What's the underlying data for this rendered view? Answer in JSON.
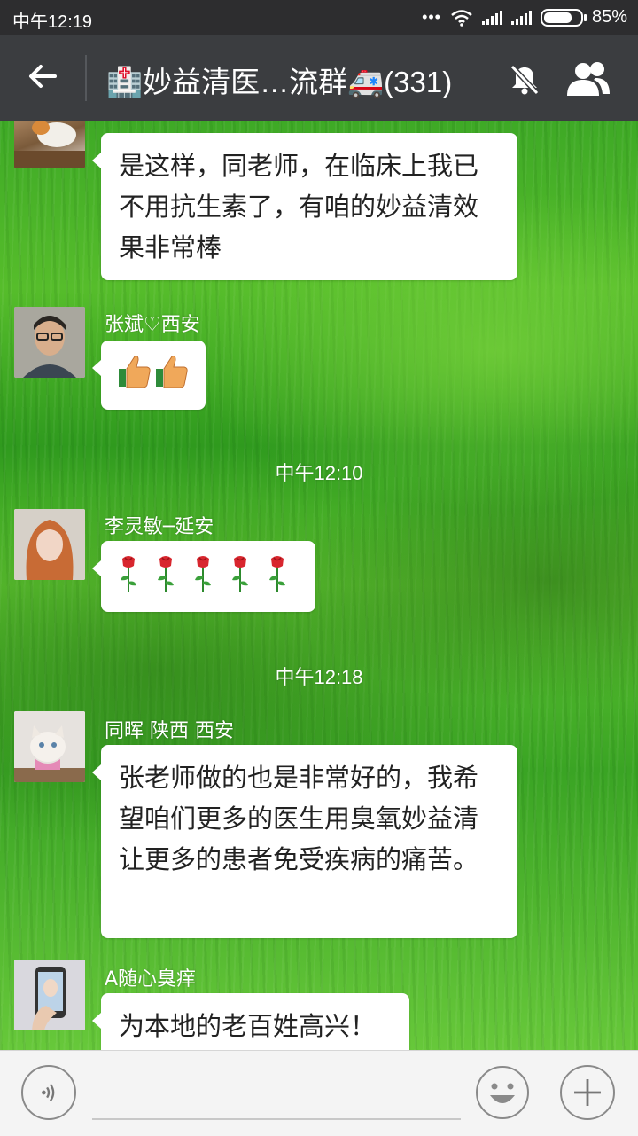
{
  "status_bar": {
    "time": "中午12:19",
    "more": "•••",
    "battery_percent_text": "85%",
    "battery_level": 0.85
  },
  "header": {
    "title": "🏥妙益清医…流群🚑(331)"
  },
  "messages": [
    {
      "sender": "",
      "text": "是这样，同老师，在临床上我已不用抗生素了，有咱的妙益清效果非常棒"
    },
    {
      "sender": "张斌♡西安",
      "emoji": "thumbs-up x2"
    },
    {
      "timestamp": "中午12:10"
    },
    {
      "sender": "李灵敏─延安",
      "emoji": "rose x5"
    },
    {
      "timestamp": "中午12:18"
    },
    {
      "sender": "同晖  陕西  西安",
      "text": "张老师做的也是非常好的，我希望咱们更多的医生用臭氧妙益清让更多的患者免受疾病的痛苦。"
    },
    {
      "sender": "A随心臭痒",
      "text": "为本地的老百姓高兴！"
    }
  ],
  "icons": {
    "back": "arrow-left-icon",
    "mute": "bell-off-icon",
    "members": "group-icon",
    "voice": "voice-icon",
    "emoji": "smiley-icon",
    "more": "plus-icon"
  },
  "colors": {
    "status_bar_bg": "#2d2d2f",
    "title_bar_bg": "#3b3d40",
    "bubble_bg": "#ffffff",
    "input_bar_bg": "#f4f4f4"
  }
}
